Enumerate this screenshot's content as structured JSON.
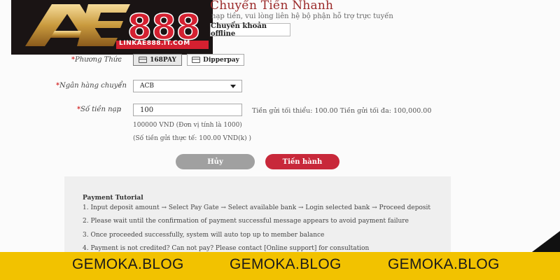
{
  "logo": {
    "brand": "AE888",
    "subtext": "LINKAE888.IT.COM"
  },
  "header": {
    "title": "Chuyển Tiền Nhanh",
    "subtitle": "nạp tiền, vui lòng liên hệ bộ phận hỗ trợ trực tuyến",
    "offline_button": "Chuyển khoản offline"
  },
  "form": {
    "method_label": "Phương Thức",
    "bank_label": "Ngân hàng chuyển",
    "amount_label": "Số tiền nạp",
    "colon": ":",
    "required_mark": "*",
    "pay_options": [
      {
        "label": "168PAY",
        "icon": "card-icon",
        "selected": true
      },
      {
        "label": "Dipperpay",
        "icon": "card-icon",
        "selected": false
      }
    ],
    "bank_selected": "ACB",
    "amount_value": "100",
    "limits_text": "Tiền gửi tối thiểu: 100.00 Tiền gửi tối đa: 100,000.00",
    "unit_note": "100000 VND (Đơn vị tính là 1000)",
    "actual_note": "(Số tiền gửi thực tế: 100.00 VND(k) )"
  },
  "actions": {
    "cancel": "Hủy",
    "proceed": "Tiến hành"
  },
  "tutorial": {
    "title": "Payment Tutorial",
    "steps": [
      "1. Input deposit amount → Select Pay Gate → Select available bank → Login selected bank → Proceed deposit",
      "2. Please wait until the confirmation of payment successful message appears to avoid payment failure",
      "3. Once proceeded successfully, system will auto top up to member balance",
      "4. Payment is not credited? Can not pay? Please contact [Online support] for consultation"
    ]
  },
  "watermark": {
    "items": [
      "GEMOKA.BLOG",
      "GEMOKA.BLOG",
      "GEMOKA.BLOG"
    ]
  },
  "colors": {
    "primary": "#c8283a",
    "cancel": "#a0a0a0",
    "banner": "#f2c200",
    "title": "#9b2a2a"
  }
}
